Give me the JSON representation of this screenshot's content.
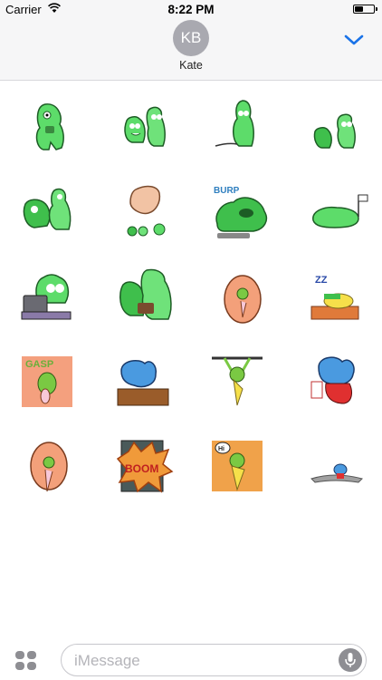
{
  "status_bar": {
    "carrier": "Carrier",
    "time": "8:22 PM"
  },
  "header": {
    "avatar_initials": "KB",
    "contact_name": "Kate"
  },
  "stickers": [
    {
      "name": "green-monster-eating"
    },
    {
      "name": "green-monster-pair-waving"
    },
    {
      "name": "green-monster-plugged-in"
    },
    {
      "name": "green-monster-big-and-small"
    },
    {
      "name": "green-monster-hugging"
    },
    {
      "name": "giant-nose-tiny-monsters"
    },
    {
      "name": "green-blob-burping",
      "text": "BURP"
    },
    {
      "name": "green-monster-lying-with-flag"
    },
    {
      "name": "green-monster-at-laptop"
    },
    {
      "name": "green-monsters-with-cake"
    },
    {
      "name": "orange-bird-in-egg"
    },
    {
      "name": "yellow-bird-sleeping",
      "text": "ZZ"
    },
    {
      "name": "orange-bird-gasp",
      "text": "GASP"
    },
    {
      "name": "blue-creature-at-desk"
    },
    {
      "name": "yellow-bird-pull-up"
    },
    {
      "name": "blue-creature-with-cup"
    },
    {
      "name": "orange-bird-egg-tongue"
    },
    {
      "name": "boom-explosion",
      "text": "BOOM"
    },
    {
      "name": "yellow-bird-saying-hi",
      "text": "Hi"
    },
    {
      "name": "blue-creature-on-rug"
    }
  ],
  "message_input": {
    "placeholder": "iMessage",
    "value": ""
  }
}
